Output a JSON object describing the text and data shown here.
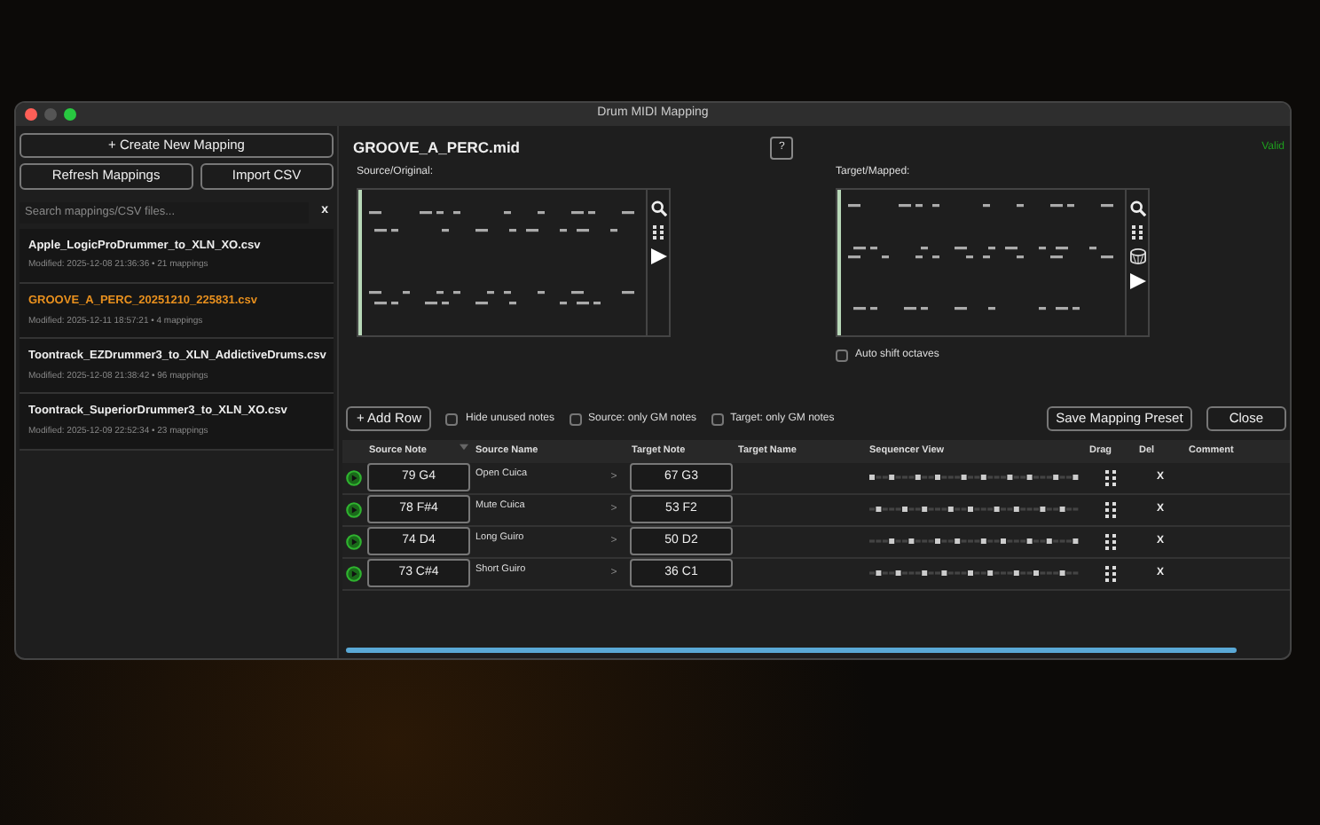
{
  "window": {
    "title": "Drum MIDI Mapping"
  },
  "sidebar": {
    "create_button": "+ Create New Mapping",
    "refresh_button": "Refresh Mappings",
    "import_button": "Import CSV",
    "search": {
      "placeholder": "Search mappings/CSV files..."
    },
    "clear_button": "x",
    "files": [
      {
        "name": "Apple_LogicProDrummer_to_XLN_XO.csv",
        "meta": "Modified: 2025-12-08 21:36:36 • 21 mappings",
        "selected": false
      },
      {
        "name": "GROOVE_A_PERC_20251210_225831.csv",
        "meta": "Modified: 2025-12-11 18:57:21 • 4 mappings",
        "selected": true
      },
      {
        "name": "Toontrack_EZDrummer3_to_XLN_AddictiveDrums.csv",
        "meta": "Modified: 2025-12-08 21:38:42 • 96 mappings",
        "selected": false
      },
      {
        "name": "Toontrack_SuperiorDrummer3_to_XLN_XO.csv",
        "meta": "Modified: 2025-12-09 22:52:34 • 23 mappings",
        "selected": false
      }
    ]
  },
  "main": {
    "file_title": "GROOVE_A_PERC.mid",
    "help_button": "?",
    "status": "Valid",
    "source_label": "Source/Original:",
    "target_label": "Target/Mapped:",
    "auto_shift": {
      "label": "Auto shift octaves",
      "checked": false
    },
    "toolbar": {
      "add_row": "+ Add Row",
      "filters": [
        {
          "label": "Hide unused notes",
          "checked": false
        },
        {
          "label": "Source: only GM notes",
          "checked": false
        },
        {
          "label": "Target: only GM notes",
          "checked": false
        }
      ],
      "save_button": "Save Mapping Preset",
      "close_button": "Close"
    },
    "table": {
      "columns": [
        "Source Note",
        "Source Name",
        "Target Note",
        "Target Name",
        "Sequencer View",
        "Drag",
        "Del",
        "Comment"
      ],
      "rows": [
        {
          "source_note": "79 G4",
          "source_name": "Open Cuica",
          "arrow": ">",
          "target_note": "67 G3",
          "delete": "X"
        },
        {
          "source_note": "78 F#4",
          "source_name": "Mute Cuica",
          "arrow": ">",
          "target_note": "53 F2",
          "delete": "X"
        },
        {
          "source_note": "74 D4",
          "source_name": "Long Guiro",
          "arrow": ">",
          "target_note": "50 D2",
          "delete": "X"
        },
        {
          "source_note": "73 C#4",
          "source_name": "Short Guiro",
          "arrow": ">",
          "target_note": "36 C1",
          "delete": "X"
        }
      ]
    }
  }
}
